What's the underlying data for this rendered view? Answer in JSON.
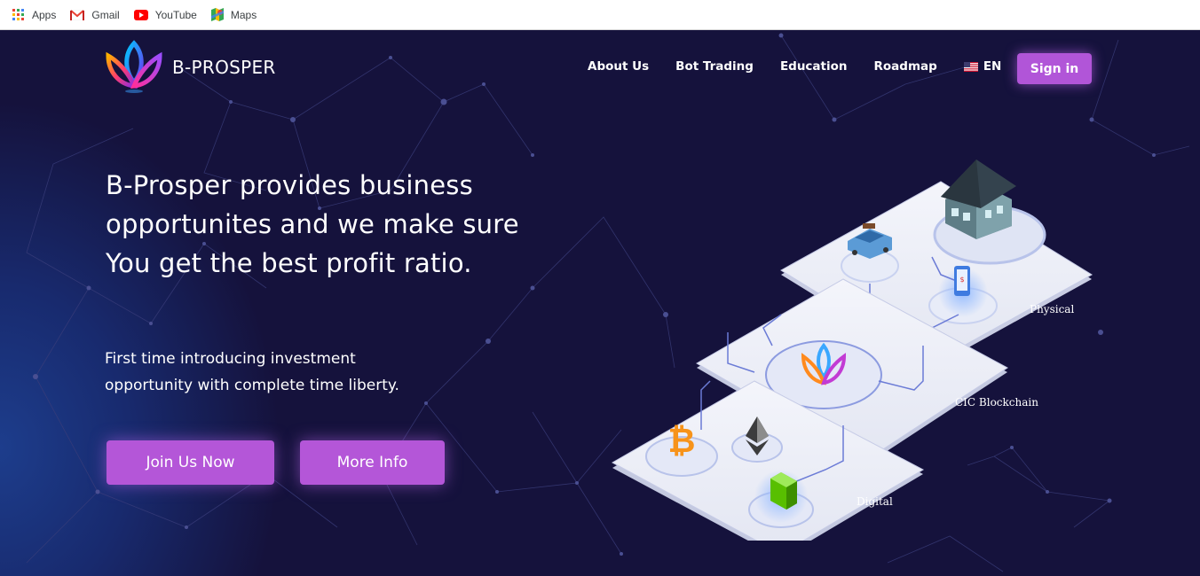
{
  "bookmarks": [
    {
      "label": "Apps",
      "icon": "apps-grid-icon"
    },
    {
      "label": "Gmail",
      "icon": "gmail-icon"
    },
    {
      "label": "YouTube",
      "icon": "youtube-icon"
    },
    {
      "label": "Maps",
      "icon": "maps-icon"
    }
  ],
  "brand": {
    "name": "B-PROSPER"
  },
  "nav": {
    "items": [
      "About Us",
      "Bot Trading",
      "Education",
      "Roadmap"
    ],
    "language": "EN",
    "signin_label": "Sign in"
  },
  "hero": {
    "title_lines": [
      "B-Prosper provides business",
      "opportunites and we make sure",
      "You get the best profit ratio."
    ],
    "subtitle_lines": [
      "First time introducing investment",
      "opportunity with complete time liberty."
    ],
    "join_label": "Join Us Now",
    "more_label": "More Info"
  },
  "illustration": {
    "labels": {
      "physical": "Physical",
      "blockchain": "CIC Blockchain",
      "digital": "Digital"
    }
  },
  "colors": {
    "background": "#15123c",
    "accent": "#b456d8",
    "text": "#ffffff"
  }
}
